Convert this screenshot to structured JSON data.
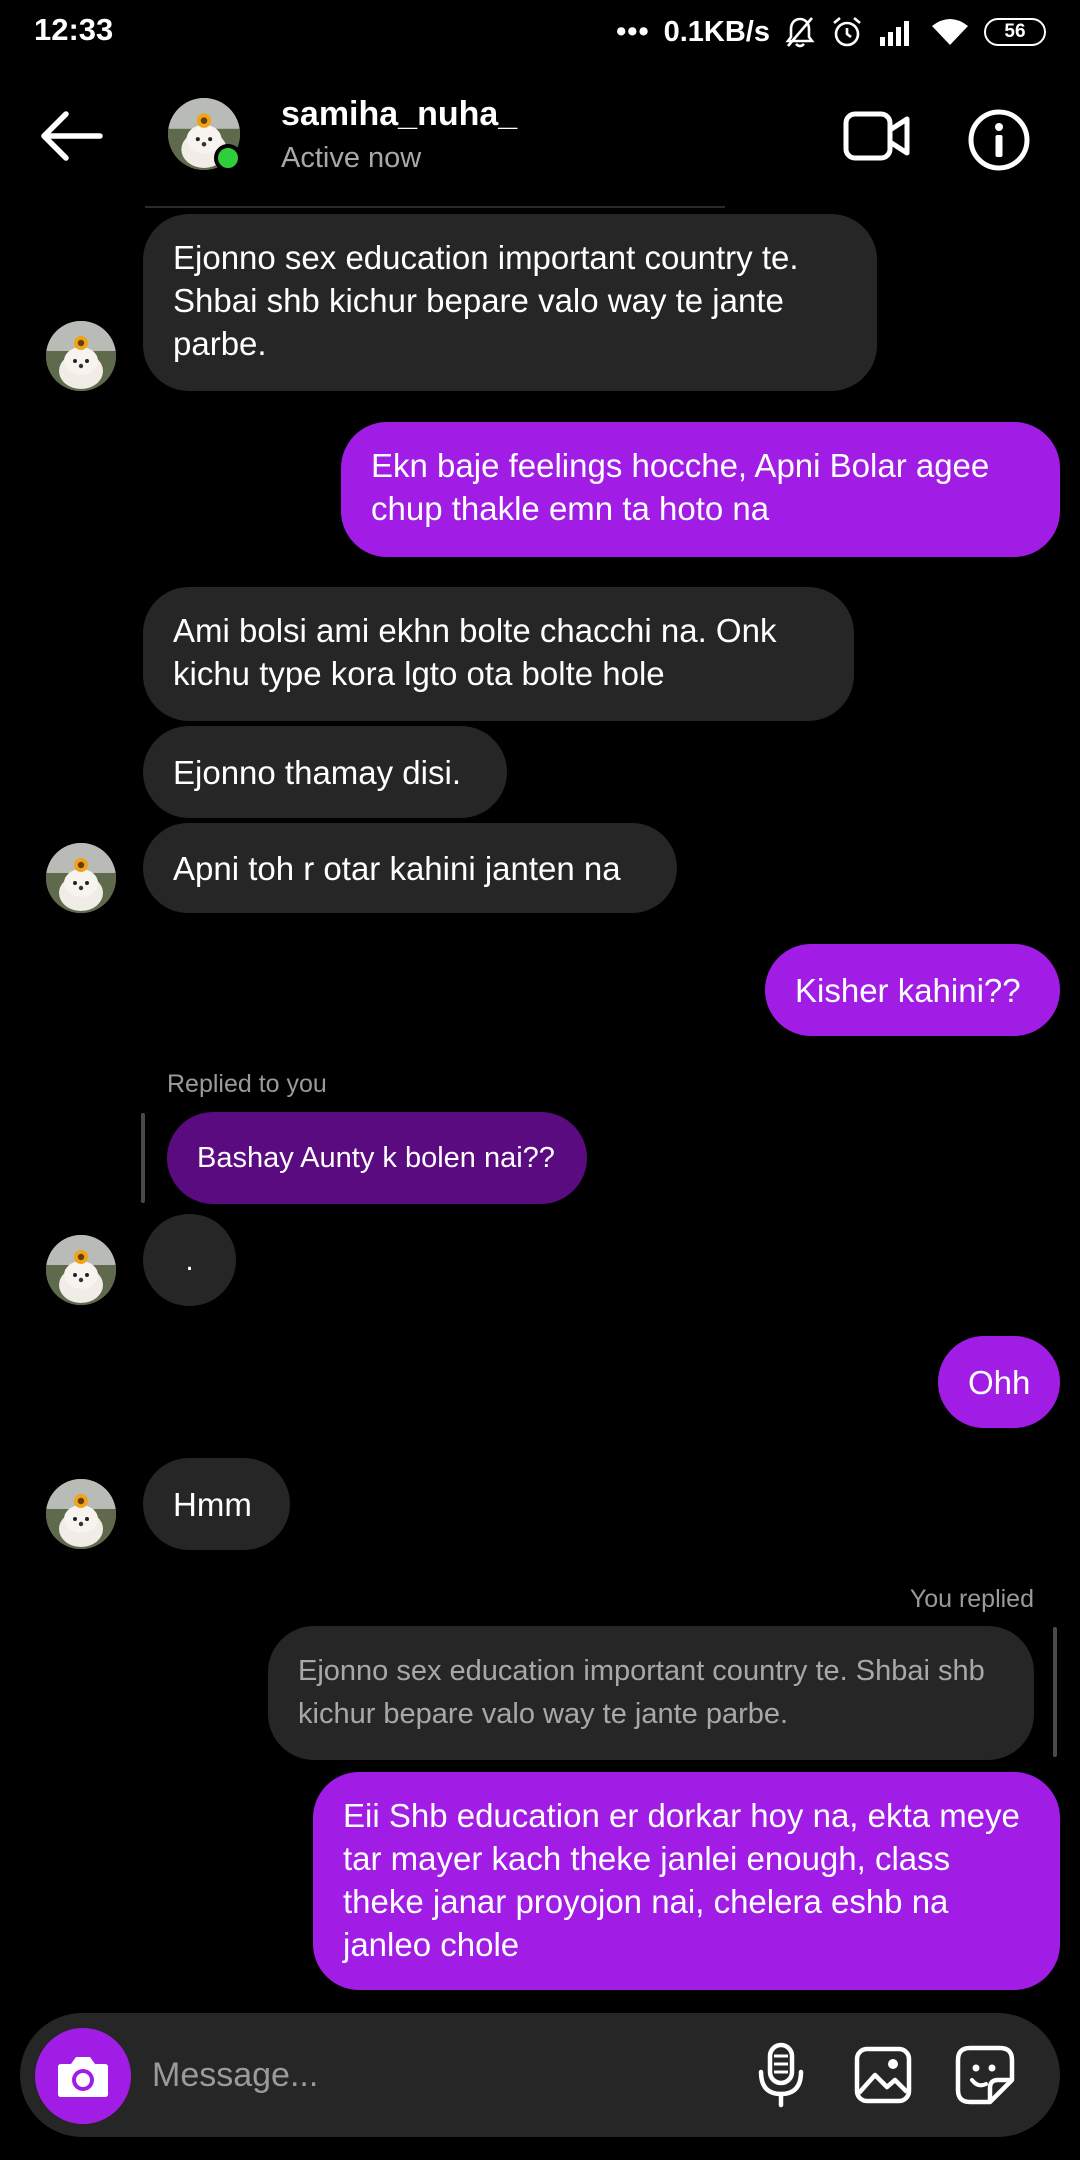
{
  "status_bar": {
    "time": "12:33",
    "network_speed": "0.1KB/s",
    "battery": "56"
  },
  "header": {
    "name": "samiha_nuha_",
    "status": "Active now"
  },
  "messages": [
    {
      "from": "them",
      "text": "Ejonno sex education important country te. Shbai shb kichur bepare valo way te jante parbe."
    },
    {
      "from": "me",
      "text": "Ekn baje feelings hocche, Apni Bolar agee chup thakle emn ta hoto na"
    },
    {
      "from": "them",
      "text": "Ami bolsi ami ekhn bolte chacchi na. Onk kichu type kora lgto ota bolte hole"
    },
    {
      "from": "them",
      "text": "Ejonno thamay disi."
    },
    {
      "from": "them",
      "text": "Apni toh r otar kahini janten na"
    },
    {
      "from": "me",
      "text": "Kisher kahini??"
    },
    {
      "from": "them",
      "text": ".",
      "reply_label": "Replied to you",
      "quoted": "Bashay Aunty k bolen nai??"
    },
    {
      "from": "me",
      "text": "Ohh"
    },
    {
      "from": "them",
      "text": "Hmm"
    },
    {
      "from": "me",
      "text": "Eii Shb education er dorkar hoy na, ekta meye tar mayer kach theke janlei enough, class theke janar proyojon nai, chelera eshb na janleo chole",
      "reply_label": "You replied",
      "quoted": "Ejonno sex education important country te. Shbai shb kichur bepare valo way te jante parbe."
    }
  ],
  "composer": {
    "placeholder": "Message..."
  },
  "colors": {
    "outgoing": "#a11de6",
    "incoming": "#262626",
    "background": "#000000",
    "online": "#2fcf3c"
  }
}
